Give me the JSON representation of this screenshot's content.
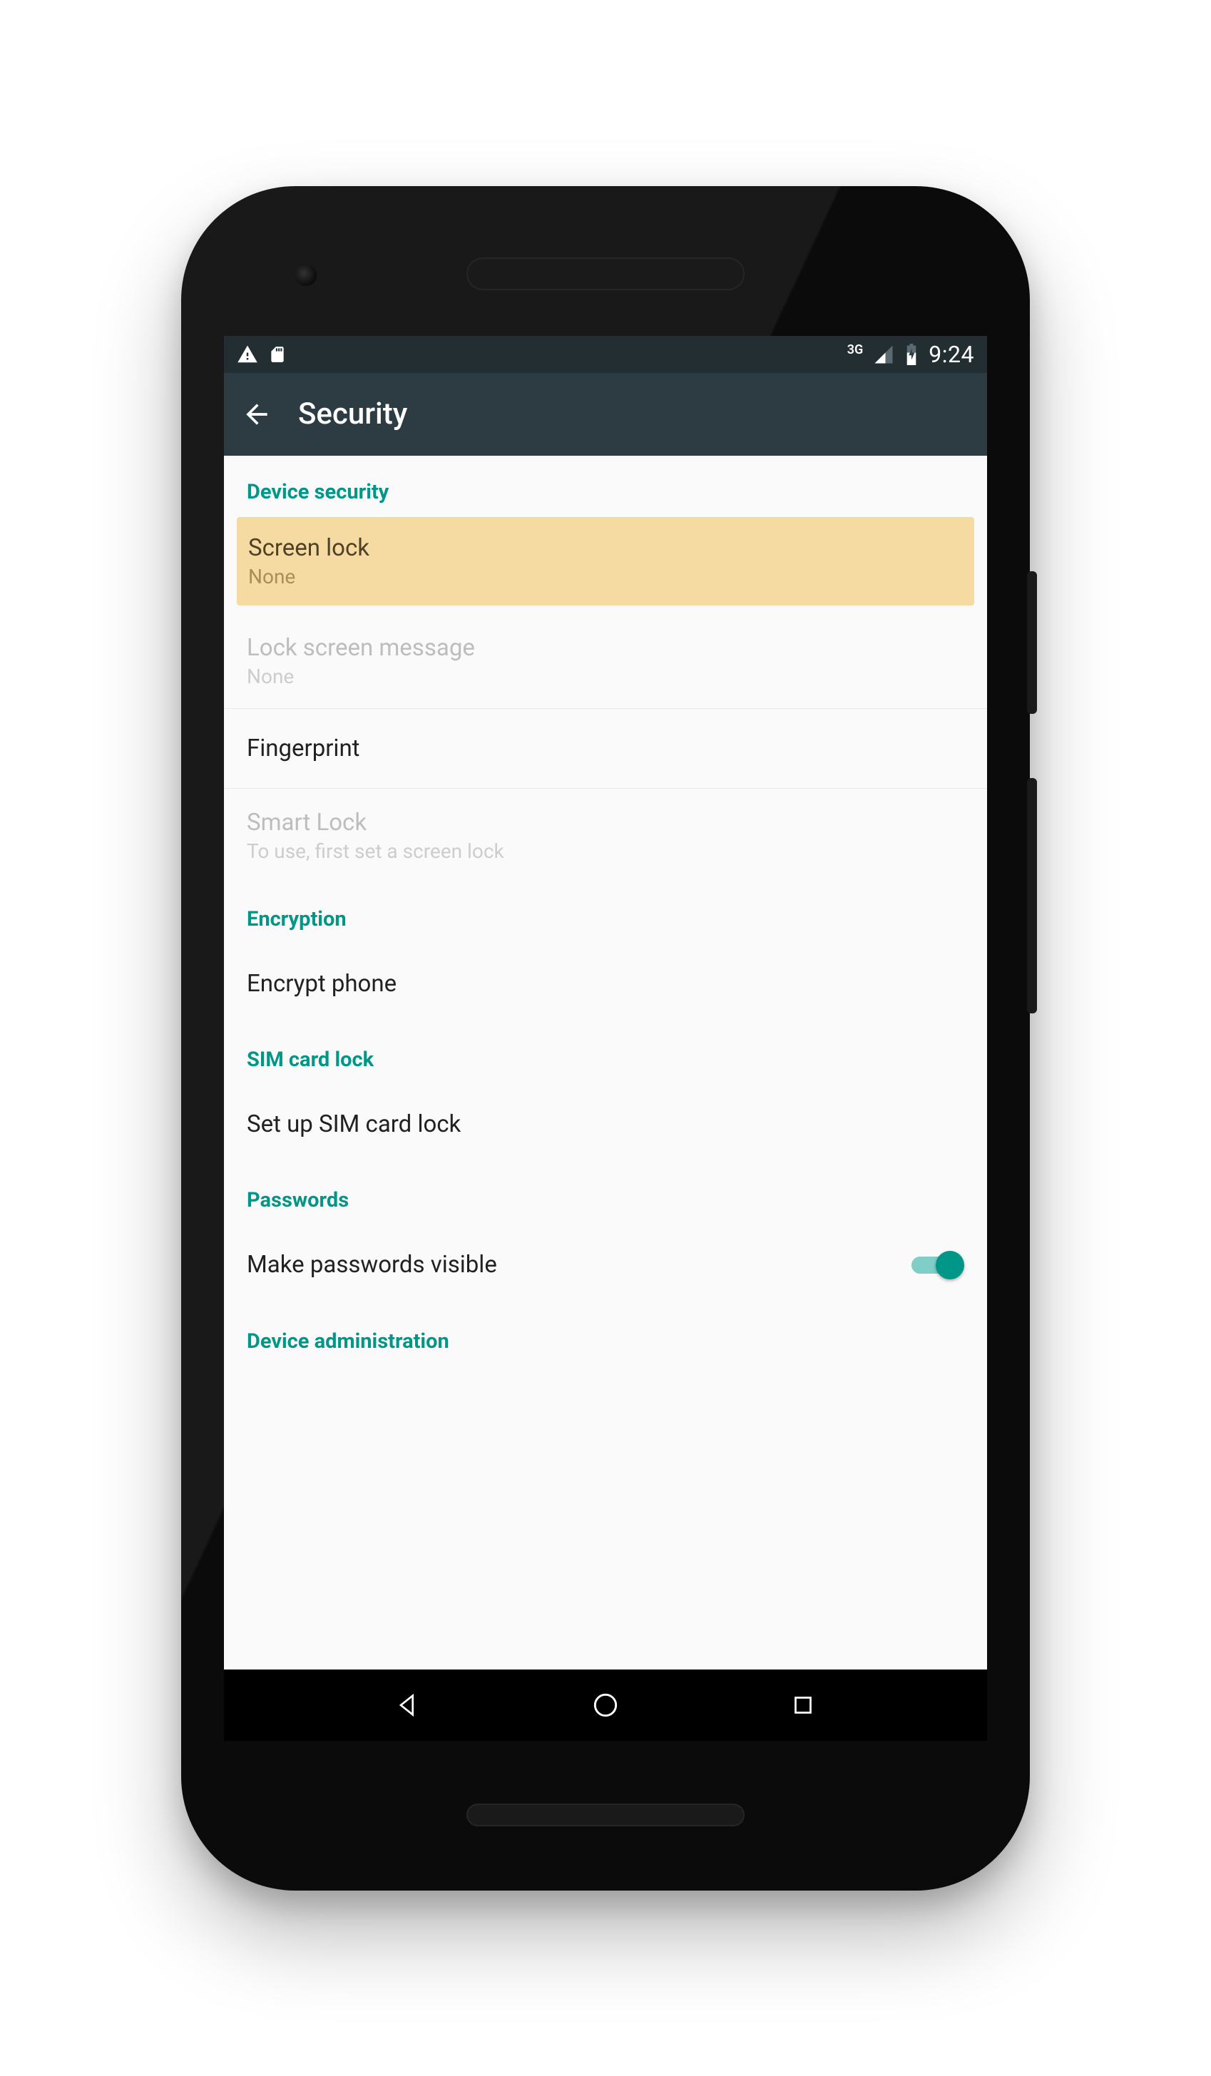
{
  "status": {
    "network_label": "3G",
    "clock": "9:24"
  },
  "appbar": {
    "title": "Security"
  },
  "sections": {
    "device_security": {
      "header": "Device security",
      "screen_lock": {
        "title": "Screen lock",
        "value": "None"
      },
      "lock_message": {
        "title": "Lock screen message",
        "value": "None"
      },
      "fingerprint": {
        "title": "Fingerprint"
      },
      "smart_lock": {
        "title": "Smart Lock",
        "value": "To use, first set a screen lock"
      }
    },
    "encryption": {
      "header": "Encryption",
      "encrypt": {
        "title": "Encrypt phone"
      }
    },
    "sim": {
      "header": "SIM card lock",
      "setup": {
        "title": "Set up SIM card lock"
      }
    },
    "passwords": {
      "header": "Passwords",
      "visible": {
        "title": "Make passwords visible",
        "enabled": true
      }
    },
    "device_admin": {
      "header": "Device administration"
    }
  }
}
